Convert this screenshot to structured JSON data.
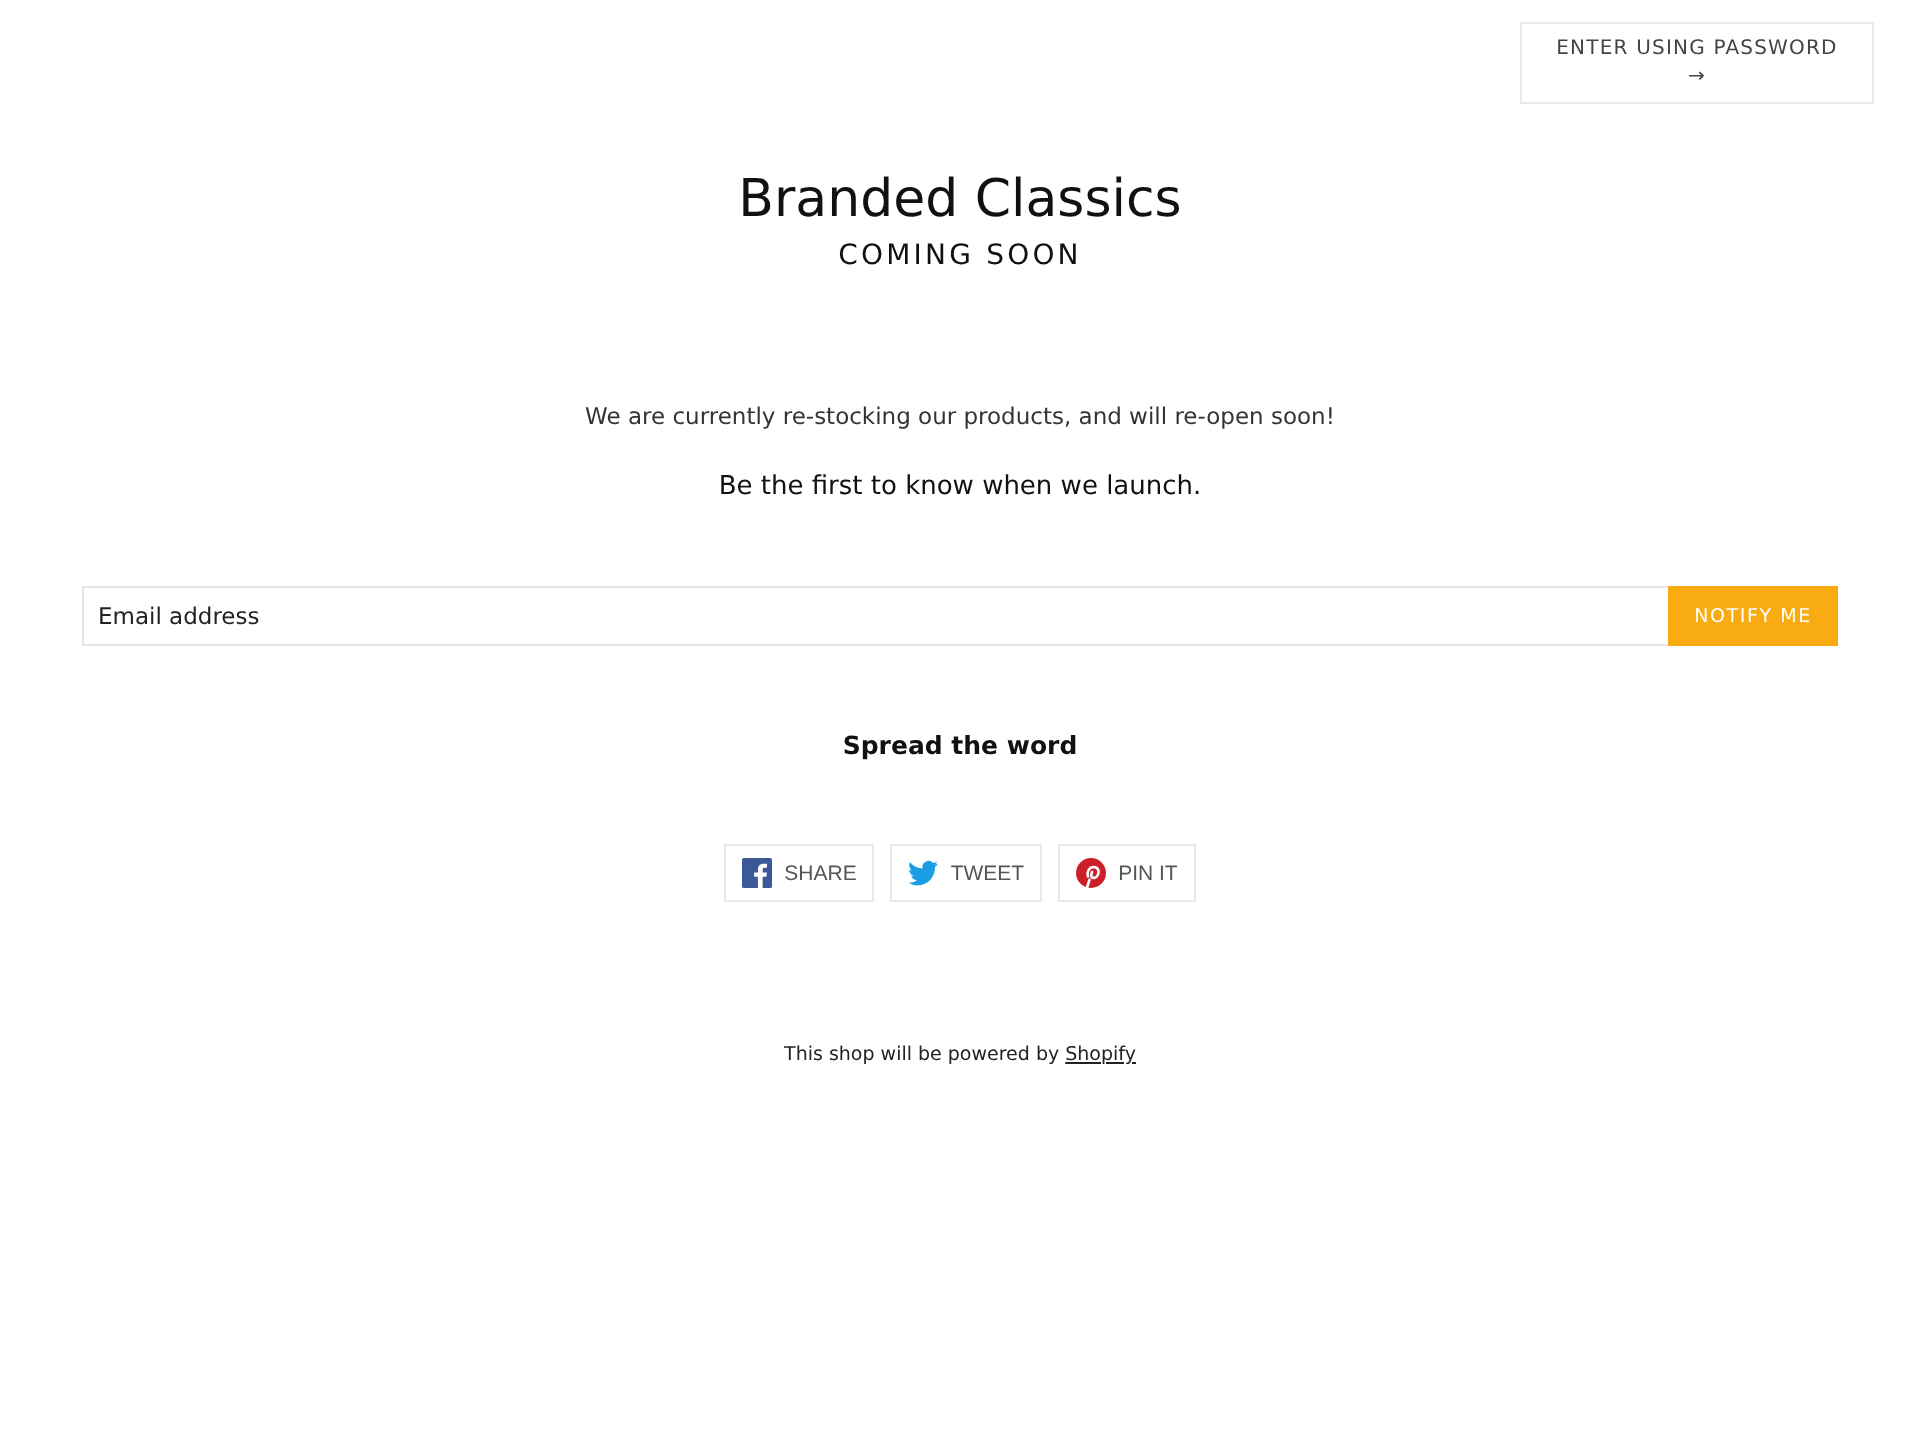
{
  "password_button": {
    "label": "ENTER USING PASSWORD",
    "arrow": "→"
  },
  "header": {
    "title": "Branded Classics",
    "subtitle": "COMING SOON"
  },
  "message": "We are currently re-stocking our products, and will re-open soon!",
  "signup": {
    "heading": "Be the first to know when we launch.",
    "email_field": {
      "placeholder": "Email address"
    },
    "button": "NOTIFY ME"
  },
  "share": {
    "heading": "Spread the word",
    "buttons": [
      {
        "kind": "facebook",
        "label": "SHARE"
      },
      {
        "kind": "twitter",
        "label": "TWEET"
      },
      {
        "kind": "pinterest",
        "label": "PIN IT"
      }
    ]
  },
  "footer": {
    "text": "This shop will be powered by",
    "link": "Shopify"
  }
}
